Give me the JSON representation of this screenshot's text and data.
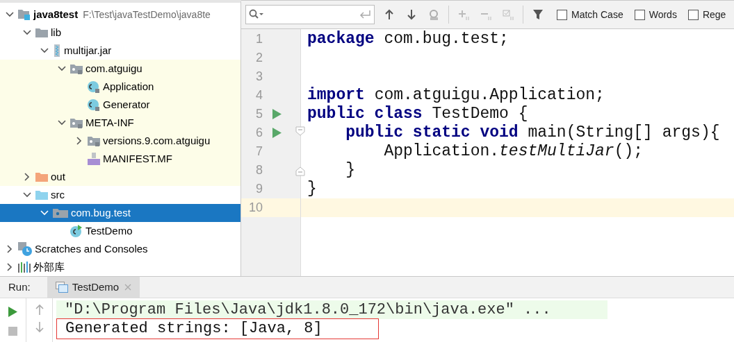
{
  "project_tree": {
    "items": [
      {
        "kind": "module",
        "label": "java8test",
        "path": "F:\\Test\\javaTestDemo\\java8te",
        "expanded": true,
        "selected": false,
        "highlighted": false,
        "children": [
          {
            "kind": "folder",
            "label": "lib",
            "expanded": true,
            "selected": false,
            "highlighted": false,
            "children": [
              {
                "kind": "jar",
                "label": "multijar.jar",
                "expanded": true,
                "selected": false,
                "highlighted": false,
                "children": [
                  {
                    "kind": "package-locked",
                    "label": "com.atguigu",
                    "expanded": true,
                    "selected": false,
                    "highlighted": true,
                    "children": [
                      {
                        "kind": "class-locked",
                        "label": "Application",
                        "selected": false,
                        "highlighted": true
                      },
                      {
                        "kind": "class-locked",
                        "label": "Generator",
                        "selected": false,
                        "highlighted": true
                      }
                    ]
                  },
                  {
                    "kind": "package-locked",
                    "label": "META-INF",
                    "expanded": true,
                    "selected": false,
                    "highlighted": true,
                    "children": [
                      {
                        "kind": "package-locked",
                        "label": "versions.9.com.atguigu",
                        "expanded": false,
                        "selected": false,
                        "highlighted": true
                      },
                      {
                        "kind": "manifest",
                        "label": "MANIFEST.MF",
                        "selected": false,
                        "highlighted": true
                      }
                    ]
                  }
                ]
              }
            ]
          },
          {
            "kind": "folder-orange",
            "label": "out",
            "expanded": false,
            "selected": false,
            "highlighted": true
          },
          {
            "kind": "folder-blue",
            "label": "src",
            "expanded": true,
            "selected": false,
            "highlighted": false,
            "children": [
              {
                "kind": "package",
                "label": "com.bug.test",
                "expanded": true,
                "selected": true,
                "highlighted": false,
                "children": [
                  {
                    "kind": "class-runnable",
                    "label": "TestDemo",
                    "selected": false,
                    "highlighted": false
                  }
                ]
              }
            ]
          }
        ]
      },
      {
        "kind": "scratches",
        "label": "Scratches and Consoles",
        "expanded": false,
        "selected": false,
        "highlighted": false
      },
      {
        "kind": "library",
        "label": "外部库",
        "expanded": false,
        "selected": false,
        "highlighted": false
      }
    ]
  },
  "find_bar": {
    "options": [
      {
        "label": "Match Case",
        "checked": false
      },
      {
        "label": "Words",
        "checked": false
      },
      {
        "label": "Rege",
        "checked": false
      }
    ]
  },
  "editor": {
    "lines": [
      {
        "number": "1",
        "current": false,
        "run_marker": false,
        "fold_open": false,
        "fold_close": false,
        "tokens": [
          {
            "text": "package",
            "kind": "keyword"
          },
          {
            "text": " com.bug.test;",
            "kind": "plain"
          }
        ]
      },
      {
        "number": "2",
        "current": false,
        "run_marker": false,
        "fold_open": false,
        "fold_close": false
      },
      {
        "number": "3",
        "current": false,
        "run_marker": false,
        "fold_open": false,
        "fold_close": false
      },
      {
        "number": "4",
        "current": false,
        "run_marker": false,
        "fold_open": false,
        "fold_close": false,
        "tokens": [
          {
            "text": "import",
            "kind": "keyword"
          },
          {
            "text": " com.atguigu.Application;",
            "kind": "plain"
          }
        ]
      },
      {
        "number": "5",
        "current": false,
        "run_marker": true,
        "fold_open": false,
        "fold_close": false,
        "tokens": [
          {
            "text": "public class",
            "kind": "keyword"
          },
          {
            "text": " TestDemo {",
            "kind": "plain"
          }
        ]
      },
      {
        "number": "6",
        "current": false,
        "run_marker": true,
        "fold_open": true,
        "fold_close": false,
        "tokens": [
          {
            "text": "    public static void",
            "kind": "keyword"
          },
          {
            "text": " main(String[] args){",
            "kind": "plain"
          }
        ]
      },
      {
        "number": "7",
        "current": false,
        "run_marker": false,
        "fold_open": false,
        "fold_close": false,
        "tokens": [
          {
            "text": "        Application.",
            "kind": "plain"
          },
          {
            "text": "testMultiJar",
            "kind": "static-call"
          },
          {
            "text": "();",
            "kind": "plain"
          }
        ]
      },
      {
        "number": "8",
        "current": false,
        "run_marker": false,
        "fold_open": false,
        "fold_close": true,
        "tokens": [
          {
            "text": "    }",
            "kind": "plain"
          }
        ]
      },
      {
        "number": "9",
        "current": false,
        "run_marker": false,
        "fold_open": false,
        "fold_close": false,
        "tokens": [
          {
            "text": "}",
            "kind": "plain"
          }
        ]
      },
      {
        "number": "10",
        "current": true,
        "run_marker": false,
        "fold_open": false,
        "fold_close": false
      }
    ]
  },
  "run_panel": {
    "label": "Run:",
    "tabs": [
      {
        "label": "TestDemo",
        "selected": true
      }
    ],
    "console": [
      {
        "text": "\"D:\\Program Files\\Java\\jdk1.8.0_172\\bin\\java.exe\" ...",
        "kind": "command",
        "boxed": false
      },
      {
        "text": "Generated strings: [Java, 8]",
        "kind": "output",
        "boxed": true
      }
    ]
  }
}
